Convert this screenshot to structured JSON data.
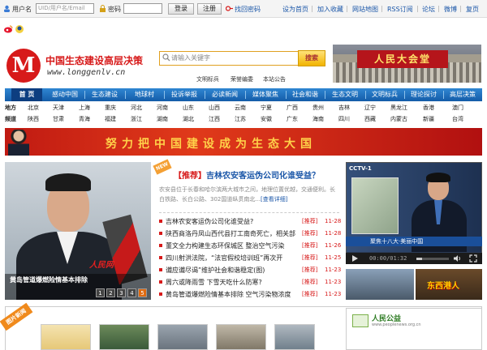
{
  "topbar": {
    "username_label": "用户名",
    "username_placeholder": "UID/用户名/Email",
    "password_label": "密码",
    "login_button": "登录",
    "register_button": "注册",
    "retrieve_password": "找回密码",
    "links": [
      "设为首页",
      "加入收藏",
      "网站地图",
      "RSS订阅",
      "论坛",
      "微博",
      "复页"
    ]
  },
  "header": {
    "site_name": "中国生态建设高层决策",
    "site_url": "www.longgenlv.cn",
    "search_placeholder": "请输入关键字",
    "search_button": "搜索",
    "hot_links": [
      "文明标兵",
      "荣誉编委",
      "本站公告"
    ],
    "header_sign": "人民大会堂"
  },
  "nav": {
    "items": [
      "首 页",
      "感动中国",
      "生态建设",
      "地球村",
      "投诉举报",
      "必读新闻",
      "媒体聚焦",
      "社会和谐",
      "生态文明",
      "文明标兵",
      "理论探讨",
      "高层决策"
    ]
  },
  "regions": {
    "row1_label": "地方",
    "row1": [
      "北京",
      "天津",
      "上海",
      "重庆",
      "河北",
      "河南",
      "山东",
      "山西",
      "云南",
      "宁夏",
      "广西",
      "贵州",
      "吉林",
      "辽宁",
      "黑龙江",
      "香港",
      "澳门"
    ],
    "row2_label": "频道",
    "row2": [
      "陕西",
      "甘肃",
      "青海",
      "福建",
      "浙江",
      "湖南",
      "湖北",
      "江西",
      "江苏",
      "安徽",
      "广东",
      "海南",
      "四川",
      "西藏",
      "内蒙古",
      "新疆",
      "台湾"
    ]
  },
  "banner": {
    "text": "努力把中国建设成为生态大国"
  },
  "slider": {
    "caption": "黄岛管道爆燃险情基本排除",
    "watermark": "人民网",
    "pages": [
      "1",
      "2",
      "3",
      "4",
      "5"
    ],
    "active_page": 5
  },
  "headline": {
    "prefix": "【推荐】",
    "title": "吉林农安客运伪公司化谁受益？",
    "new_tag": "NEW",
    "summary": "农安县位于长春和哈尔滨两大城市之间，地理位置优越，交通便利。长白铁路、长白公路、302国道纵贯南北...",
    "more": "[查看详细]"
  },
  "news": [
    {
      "title": "吉林农安客运伪公司化谁受益?",
      "tag": "[推荐]",
      "date": "11-28"
    },
    {
      "title": "陕西商洛丹凤山西代县打工南奇死亡，相关部",
      "tag": "[推荐]",
      "date": "11-28"
    },
    {
      "title": "董文全力构建生态环保城区 整治空气污染",
      "tag": "[推荐]",
      "date": "11-26"
    },
    {
      "title": "四川射洪法院，“法官假校培训班”再次开",
      "tag": "[推荐]",
      "date": "11-25"
    },
    {
      "title": "谶应谶尽谒”维护社会和谐稳定(图)",
      "tag": "[推荐]",
      "date": "11-23"
    },
    {
      "title": "周六或降雨雪 下雪天吃什么防寒?",
      "tag": "[推荐]",
      "date": "11-23"
    },
    {
      "title": "黄岛管道爆燃险情基本排除 空气污染物浓度",
      "tag": "[推荐]",
      "date": "11-23"
    }
  ],
  "video": {
    "channel_logo": "CCTV-1",
    "strip_text": "聚焦十八大·美丽中国",
    "time": "00:00/01:32",
    "progress": 0.18,
    "thumb2_text": "东西港人"
  },
  "bottom": {
    "ribbon": "图片新闻",
    "ad_title": "人民公益",
    "ad_url": "www.peoplenews.org.cn"
  },
  "colors": {
    "brand_red": "#d71a1a",
    "nav_blue": "#1a6bbf",
    "link_blue": "#1a56a8",
    "accent_orange": "#e06a10"
  }
}
